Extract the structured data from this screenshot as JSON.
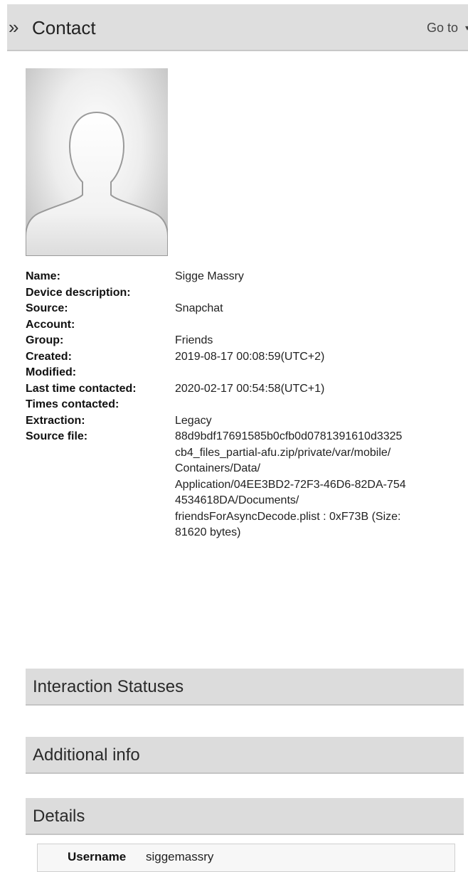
{
  "header": {
    "title": "Contact",
    "goto_label": "Go to",
    "chevron_icon": "double-chevron-right-icon",
    "dropdown_icon": "chevron-down-icon"
  },
  "avatar": {
    "icon": "person-silhouette-icon"
  },
  "fields": [
    {
      "label": "Name:",
      "value": "Sigge Massry"
    },
    {
      "label": "Device description:",
      "value": ""
    },
    {
      "label": "Source:",
      "value": "Snapchat"
    },
    {
      "label": "Account:",
      "value": ""
    },
    {
      "label": "Group:",
      "value": "Friends"
    },
    {
      "label": "Created:",
      "value": "2019-08-17 00:08:59(UTC+2)"
    },
    {
      "label": "Modified:",
      "value": ""
    },
    {
      "label": "Last time contacted:",
      "value": "2020-02-17 00:54:58(UTC+1)"
    },
    {
      "label": "Times contacted:",
      "value": ""
    },
    {
      "label": "Extraction:",
      "value": "Legacy"
    },
    {
      "label": "Source file:",
      "value": "88d9bdf17691585b0cfb0d0781391610d3325\ncb4_files_partial-afu.zip/private/var/mobile/\nContainers/Data/\nApplication/04EE3BD2-72F3-46D6-82DA-754\n4534618DA/Documents/\nfriendsForAsyncDecode.plist : 0xF73B (Size:\n81620 bytes)"
    }
  ],
  "sections": {
    "interaction": "Interaction Statuses",
    "additional": "Additional info",
    "details": "Details"
  },
  "details": {
    "key": "Username",
    "value": "siggemassry"
  }
}
